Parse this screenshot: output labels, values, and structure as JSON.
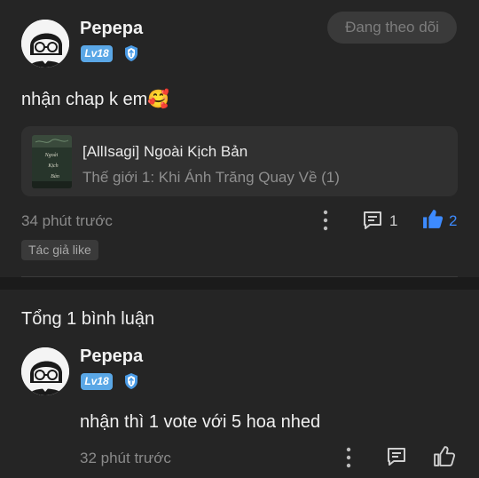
{
  "post": {
    "author": {
      "name": "Pepepa",
      "level": "Lv18"
    },
    "follow_button": "Đang theo dõi",
    "text": "nhận chap k em🥰",
    "book": {
      "title": "[AllIsagi] Ngoài Kịch Bản",
      "chapter": "Thế giới 1: Khi Ánh Trăng Quay Về (1)"
    },
    "time": "34 phút trước",
    "comment_count": "1",
    "like_count": "2",
    "author_like_tag": "Tác giả like"
  },
  "comments_section": {
    "title": "Tổng 1 bình luận",
    "comments": [
      {
        "author": {
          "name": "Pepepa",
          "level": "Lv18"
        },
        "text": "nhận thì 1 vote với 5 hoa nhed",
        "time": "32 phút trước"
      }
    ]
  },
  "colors": {
    "background": "#252525",
    "level_badge": "#5aa7e6",
    "like_active": "#3d8bff",
    "muted_text": "#8a8a8a"
  },
  "icons": [
    "more-vertical-icon",
    "comment-icon",
    "thumbs-up-icon",
    "shield-badge-icon"
  ]
}
